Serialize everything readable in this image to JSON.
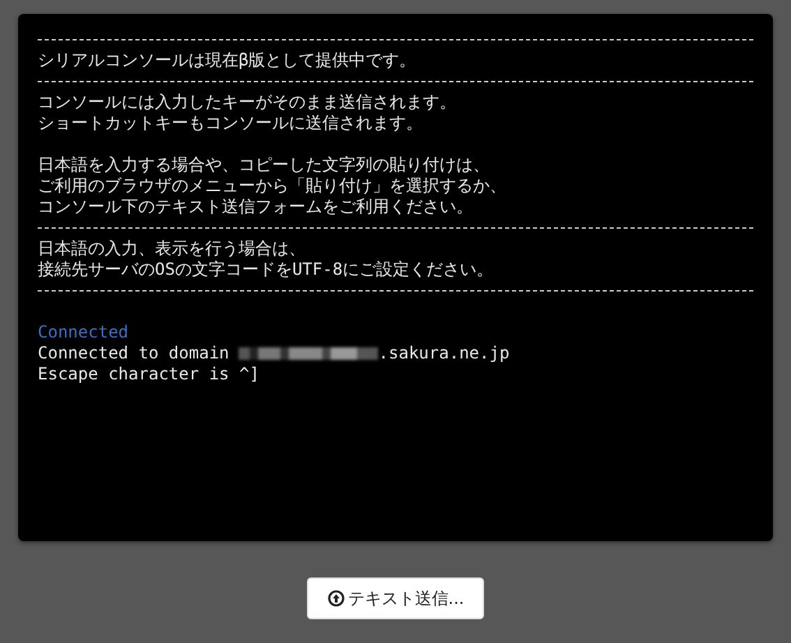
{
  "console": {
    "lines": [
      {
        "kind": "rule"
      },
      {
        "kind": "text",
        "text": "シリアルコンソールは現在β版として提供中です。"
      },
      {
        "kind": "rule"
      },
      {
        "kind": "text",
        "text": "コンソールには入力したキーがそのまま送信されます。"
      },
      {
        "kind": "text",
        "text": "ショートカットキーもコンソールに送信されます。"
      },
      {
        "kind": "blank"
      },
      {
        "kind": "text",
        "text": "日本語を入力する場合や、コピーした文字列の貼り付けは、"
      },
      {
        "kind": "text",
        "text": "ご利用のブラウザのメニューから「貼り付け」を選択するか、"
      },
      {
        "kind": "text",
        "text": "コンソール下のテキスト送信フォームをご利用ください。"
      },
      {
        "kind": "rule"
      },
      {
        "kind": "text",
        "text": "日本語の入力、表示を行う場合は、"
      },
      {
        "kind": "text",
        "text": "接続先サーバのOSの文字コードをUTF-8にご設定ください。"
      },
      {
        "kind": "rule"
      },
      {
        "kind": "blank"
      },
      {
        "kind": "status",
        "text": "Connected"
      },
      {
        "kind": "domain",
        "text": "Connected to domain",
        "suffix": ".sakura.ne.jp"
      },
      {
        "kind": "text",
        "text": "Escape character is ^]"
      }
    ]
  },
  "send_button": {
    "label": "テキスト送信..."
  }
}
